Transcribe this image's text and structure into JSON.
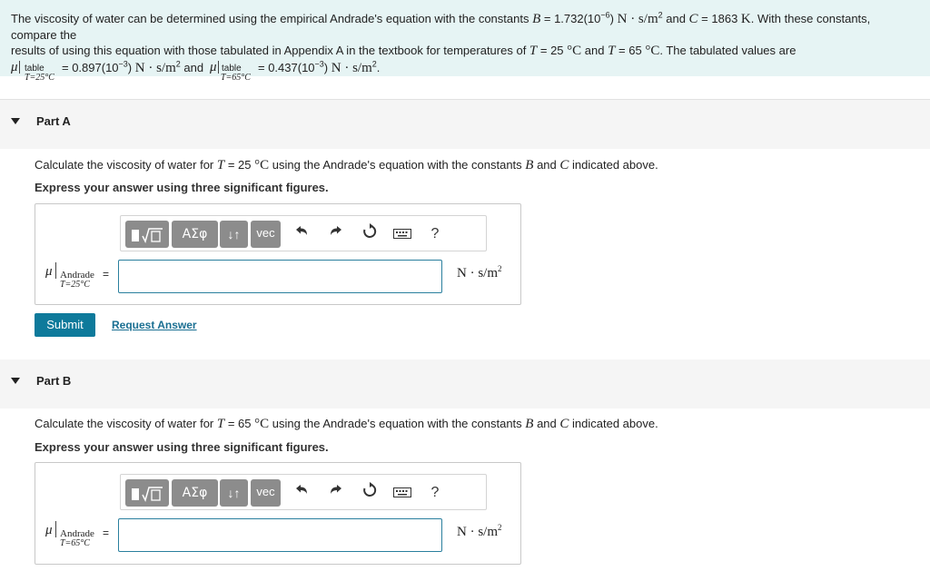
{
  "intro": {
    "line1_a": "The viscosity of water can be determined using the empirical Andrade's equation with the constants ",
    "B_sym": "B",
    "B_eq": " = 1.732(10",
    "B_exp": "−6",
    "B_close": ") ",
    "B_unit": "N · s/m",
    "B_unit_exp": "2",
    "and": " and ",
    "C_sym": "C",
    "C_eq": " = 1863 ",
    "C_unit": "K",
    "line1_b": ". With these constants, compare the",
    "line2_a": "results of using this equation with those tabulated in Appendix A in the textbook for temperatures of ",
    "T_sym": "T",
    "T1_eq": " = 25 ",
    "deg_C": "°C",
    "and2": " and ",
    "T2_eq": " = 65 ",
    "line2_b": ". The tabulated values are",
    "mu": "μ",
    "sub_table": "table",
    "sub_T25": "T=25°C",
    "sub_T65": "T=65°C",
    "v1": " = 0.897(10",
    "v_exp": "−3",
    "v_close": ") ",
    "unit": "N · s/m",
    "unit_exp": "2",
    "and3": " and ",
    "v2": " = 0.437(10",
    "end": "."
  },
  "partA": {
    "label": "Part A",
    "q_pre": "Calculate the viscosity of water for ",
    "T_sym": "T",
    "q_eq": " = 25 ",
    "deg": "°C",
    "q_mid": " using the Andrade's equation with the constants ",
    "B": "B",
    "and": " and ",
    "C": "C",
    "q_post": " indicated above.",
    "instr": "Express your answer using three significant figures.",
    "mu": "μ",
    "sub_top": "Andrade",
    "sub_bot": "T=25°C",
    "eq": "=",
    "unit": "N · s/m",
    "unit_exp": "2",
    "input_value": ""
  },
  "partB": {
    "label": "Part B",
    "q_pre": "Calculate the viscosity of water for ",
    "T_sym": "T",
    "q_eq": " = 65 ",
    "deg": "°C",
    "q_mid": " using the Andrade's equation with the constants ",
    "B": "B",
    "and": " and ",
    "C": "C",
    "q_post": " indicated above.",
    "instr": "Express your answer using three significant figures.",
    "mu": "μ",
    "sub_top": "Andrade",
    "sub_bot": "T=65°C",
    "eq": "=",
    "unit": "N · s/m",
    "unit_exp": "2",
    "input_value": ""
  },
  "toolbar": {
    "greek": "ΑΣφ",
    "arrows": "↓↑",
    "vec": "vec",
    "help": "?"
  },
  "actions": {
    "submit": "Submit",
    "request": "Request Answer"
  }
}
